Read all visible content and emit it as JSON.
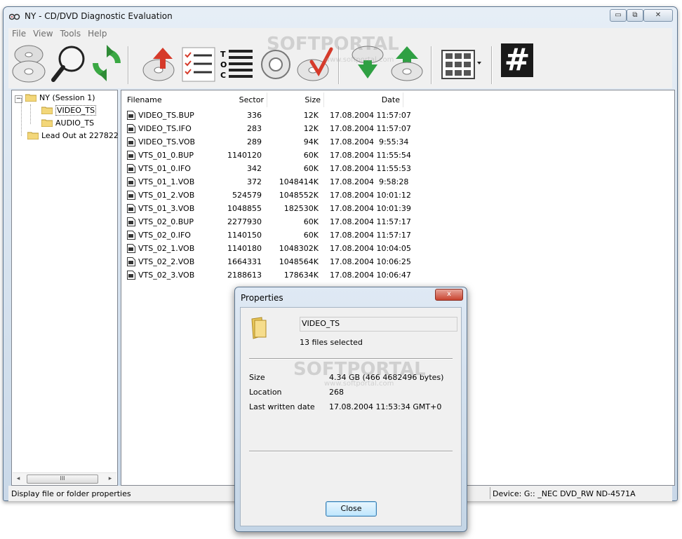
{
  "window": {
    "title": "NY - CD/DVD Diagnostic Evaluation",
    "caption_buttons": {
      "minimize": "▭",
      "maximize": "⧉",
      "close": "✕"
    }
  },
  "menu": [
    "File",
    "View",
    "Tools",
    "Help"
  ],
  "toolbar": {
    "toc_label": [
      "T",
      "O",
      "C"
    ],
    "hash_label": "#",
    "icons": [
      "disc-stack-icon",
      "magnify-icon",
      "refresh-icon",
      "disc-write-icon",
      "checklist-icon",
      "toc-icon",
      "lifebuoy-icon",
      "disc-check-icon",
      "download-icon",
      "upload-icon",
      "view-grid-icon",
      "hash-icon"
    ]
  },
  "tree": [
    {
      "label": "NY (Session 1)",
      "expander": "−"
    },
    {
      "label": "VIDEO_TS"
    },
    {
      "label": "AUDIO_TS"
    },
    {
      "label": "Lead Out at 227822"
    }
  ],
  "tree_scroll_thumb": "III",
  "columns": {
    "filename": "Filename",
    "sector": "Sector",
    "size": "Size",
    "date": "Date"
  },
  "files": [
    {
      "name": "VIDEO_TS.BUP",
      "sector": "336",
      "size": "12K",
      "date": "17.08.2004 11:57:07"
    },
    {
      "name": "VIDEO_TS.IFO",
      "sector": "283",
      "size": "12K",
      "date": "17.08.2004 11:57:07"
    },
    {
      "name": "VIDEO_TS.VOB",
      "sector": "289",
      "size": "94K",
      "date": "17.08.2004  9:55:34"
    },
    {
      "name": "VTS_01_0.BUP",
      "sector": "1140120",
      "size": "60K",
      "date": "17.08.2004 11:55:54"
    },
    {
      "name": "VTS_01_0.IFO",
      "sector": "342",
      "size": "60K",
      "date": "17.08.2004 11:55:53"
    },
    {
      "name": "VTS_01_1.VOB",
      "sector": "372",
      "size": "1048414K",
      "date": "17.08.2004  9:58:28"
    },
    {
      "name": "VTS_01_2.VOB",
      "sector": "524579",
      "size": "1048552K",
      "date": "17.08.2004 10:01:12"
    },
    {
      "name": "VTS_01_3.VOB",
      "sector": "1048855",
      "size": "182530K",
      "date": "17.08.2004 10:01:39"
    },
    {
      "name": "VTS_02_0.BUP",
      "sector": "2277930",
      "size": "60K",
      "date": "17.08.2004 11:57:17"
    },
    {
      "name": "VTS_02_0.IFO",
      "sector": "1140150",
      "size": "60K",
      "date": "17.08.2004 11:57:17"
    },
    {
      "name": "VTS_02_1.VOB",
      "sector": "1140180",
      "size": "1048302K",
      "date": "17.08.2004 10:04:05"
    },
    {
      "name": "VTS_02_2.VOB",
      "sector": "1664331",
      "size": "1048564K",
      "date": "17.08.2004 10:06:25"
    },
    {
      "name": "VTS_02_3.VOB",
      "sector": "2188613",
      "size": "178634K",
      "date": "17.08.2004 10:06:47"
    }
  ],
  "status": {
    "left": "Display file or folder properties",
    "right": "Device: G:: _NEC DVD_RW ND-4571A"
  },
  "dialog": {
    "title": "Properties",
    "close_glyph": "x",
    "name": "VIDEO_TS",
    "selection": "13 files selected",
    "size_label": "Size",
    "size_value": "4.34 GB (466 4682496 bytes)",
    "location_label": "Location",
    "location_value": "268",
    "date_label": "Last written date",
    "date_value": "17.08.2004 11:53:34 GMT+0",
    "close_button": "Close"
  },
  "watermark": {
    "brand": "SOFTPORTAL",
    "url": "www.softportal.com"
  }
}
